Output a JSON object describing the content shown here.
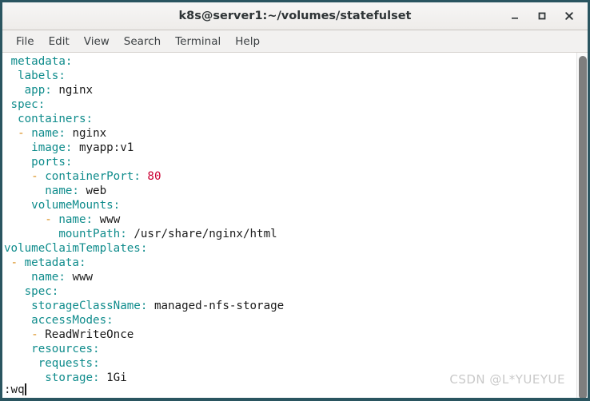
{
  "window": {
    "title": "k8s@server1:~/volumes/statefulset",
    "frame_color": "#2a5560",
    "controls": [
      {
        "name": "minimize",
        "glyph": "minimize-icon"
      },
      {
        "name": "maximize",
        "glyph": "maximize-icon"
      },
      {
        "name": "close",
        "glyph": "close-icon"
      }
    ]
  },
  "menubar": {
    "items": [
      {
        "label": "File"
      },
      {
        "label": "Edit"
      },
      {
        "label": "View"
      },
      {
        "label": "Search"
      },
      {
        "label": "Terminal"
      },
      {
        "label": "Help"
      }
    ]
  },
  "terminal": {
    "colors": {
      "key": "#0f8c8c",
      "value": "#1b1b1b",
      "number": "#cc0033",
      "dash": "#d98c1a",
      "background": "#ffffff"
    },
    "lines": [
      {
        "indent": 1,
        "dash": false,
        "key": "metadata",
        "value": ""
      },
      {
        "indent": 2,
        "dash": false,
        "key": "labels",
        "value": ""
      },
      {
        "indent": 3,
        "dash": false,
        "key": "app",
        "value": "nginx"
      },
      {
        "indent": 1,
        "dash": false,
        "key": "spec",
        "value": ""
      },
      {
        "indent": 2,
        "dash": false,
        "key": "containers",
        "value": ""
      },
      {
        "indent": 2,
        "dash": true,
        "key": "name",
        "value": "nginx"
      },
      {
        "indent": 4,
        "dash": false,
        "key": "image",
        "value": "myapp:v1"
      },
      {
        "indent": 4,
        "dash": false,
        "key": "ports",
        "value": ""
      },
      {
        "indent": 4,
        "dash": true,
        "key": "containerPort",
        "value": "80",
        "value_type": "number"
      },
      {
        "indent": 6,
        "dash": false,
        "key": "name",
        "value": "web"
      },
      {
        "indent": 4,
        "dash": false,
        "key": "volumeMounts",
        "value": ""
      },
      {
        "indent": 6,
        "dash": true,
        "key": "name",
        "value": "www"
      },
      {
        "indent": 8,
        "dash": false,
        "key": "mountPath",
        "value": "/usr/share/nginx/html"
      },
      {
        "indent": 0,
        "dash": false,
        "key": "volumeClaimTemplates",
        "value": ""
      },
      {
        "indent": 1,
        "dash": true,
        "key": "metadata",
        "value": ""
      },
      {
        "indent": 4,
        "dash": false,
        "key": "name",
        "value": "www"
      },
      {
        "indent": 3,
        "dash": false,
        "key": "spec",
        "value": ""
      },
      {
        "indent": 4,
        "dash": false,
        "key": "storageClassName",
        "value": "managed-nfs-storage"
      },
      {
        "indent": 4,
        "dash": false,
        "key": "accessModes",
        "value": ""
      },
      {
        "indent": 4,
        "dash": true,
        "key": "",
        "value": "ReadWriteOnce"
      },
      {
        "indent": 4,
        "dash": false,
        "key": "resources",
        "value": ""
      },
      {
        "indent": 5,
        "dash": false,
        "key": "requests",
        "value": ""
      },
      {
        "indent": 6,
        "dash": false,
        "key": "storage",
        "value": "1Gi"
      }
    ],
    "command_line": ":wq"
  },
  "watermark": {
    "text": "CSDN @L*YUEYUE"
  },
  "scrollbar": {
    "position_percent": 0
  }
}
